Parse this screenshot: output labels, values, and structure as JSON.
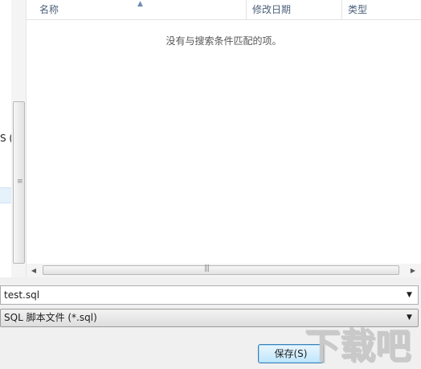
{
  "nav": {
    "truncated_item": "S ("
  },
  "file_list": {
    "columns": {
      "name": "名称",
      "date_modified": "修改日期",
      "type": "类型"
    },
    "empty_message": "没有与搜索条件匹配的项。"
  },
  "filename": {
    "value": "test.sql"
  },
  "filetype": {
    "value": "SQL 脚本文件 (*.sql)"
  },
  "buttons": {
    "save_label": "保存(S)"
  },
  "watermark": {
    "text": "下载吧",
    "colors": {
      "main": "#c9c9c9",
      "shadow": "#b0b0b0"
    }
  },
  "icons": {
    "sort": "sort-ascending-icon",
    "dropdown": "chevron-down-icon",
    "scroll_left": "arrow-left-icon",
    "scroll_right": "arrow-right-icon",
    "grip": "grip-icon"
  }
}
